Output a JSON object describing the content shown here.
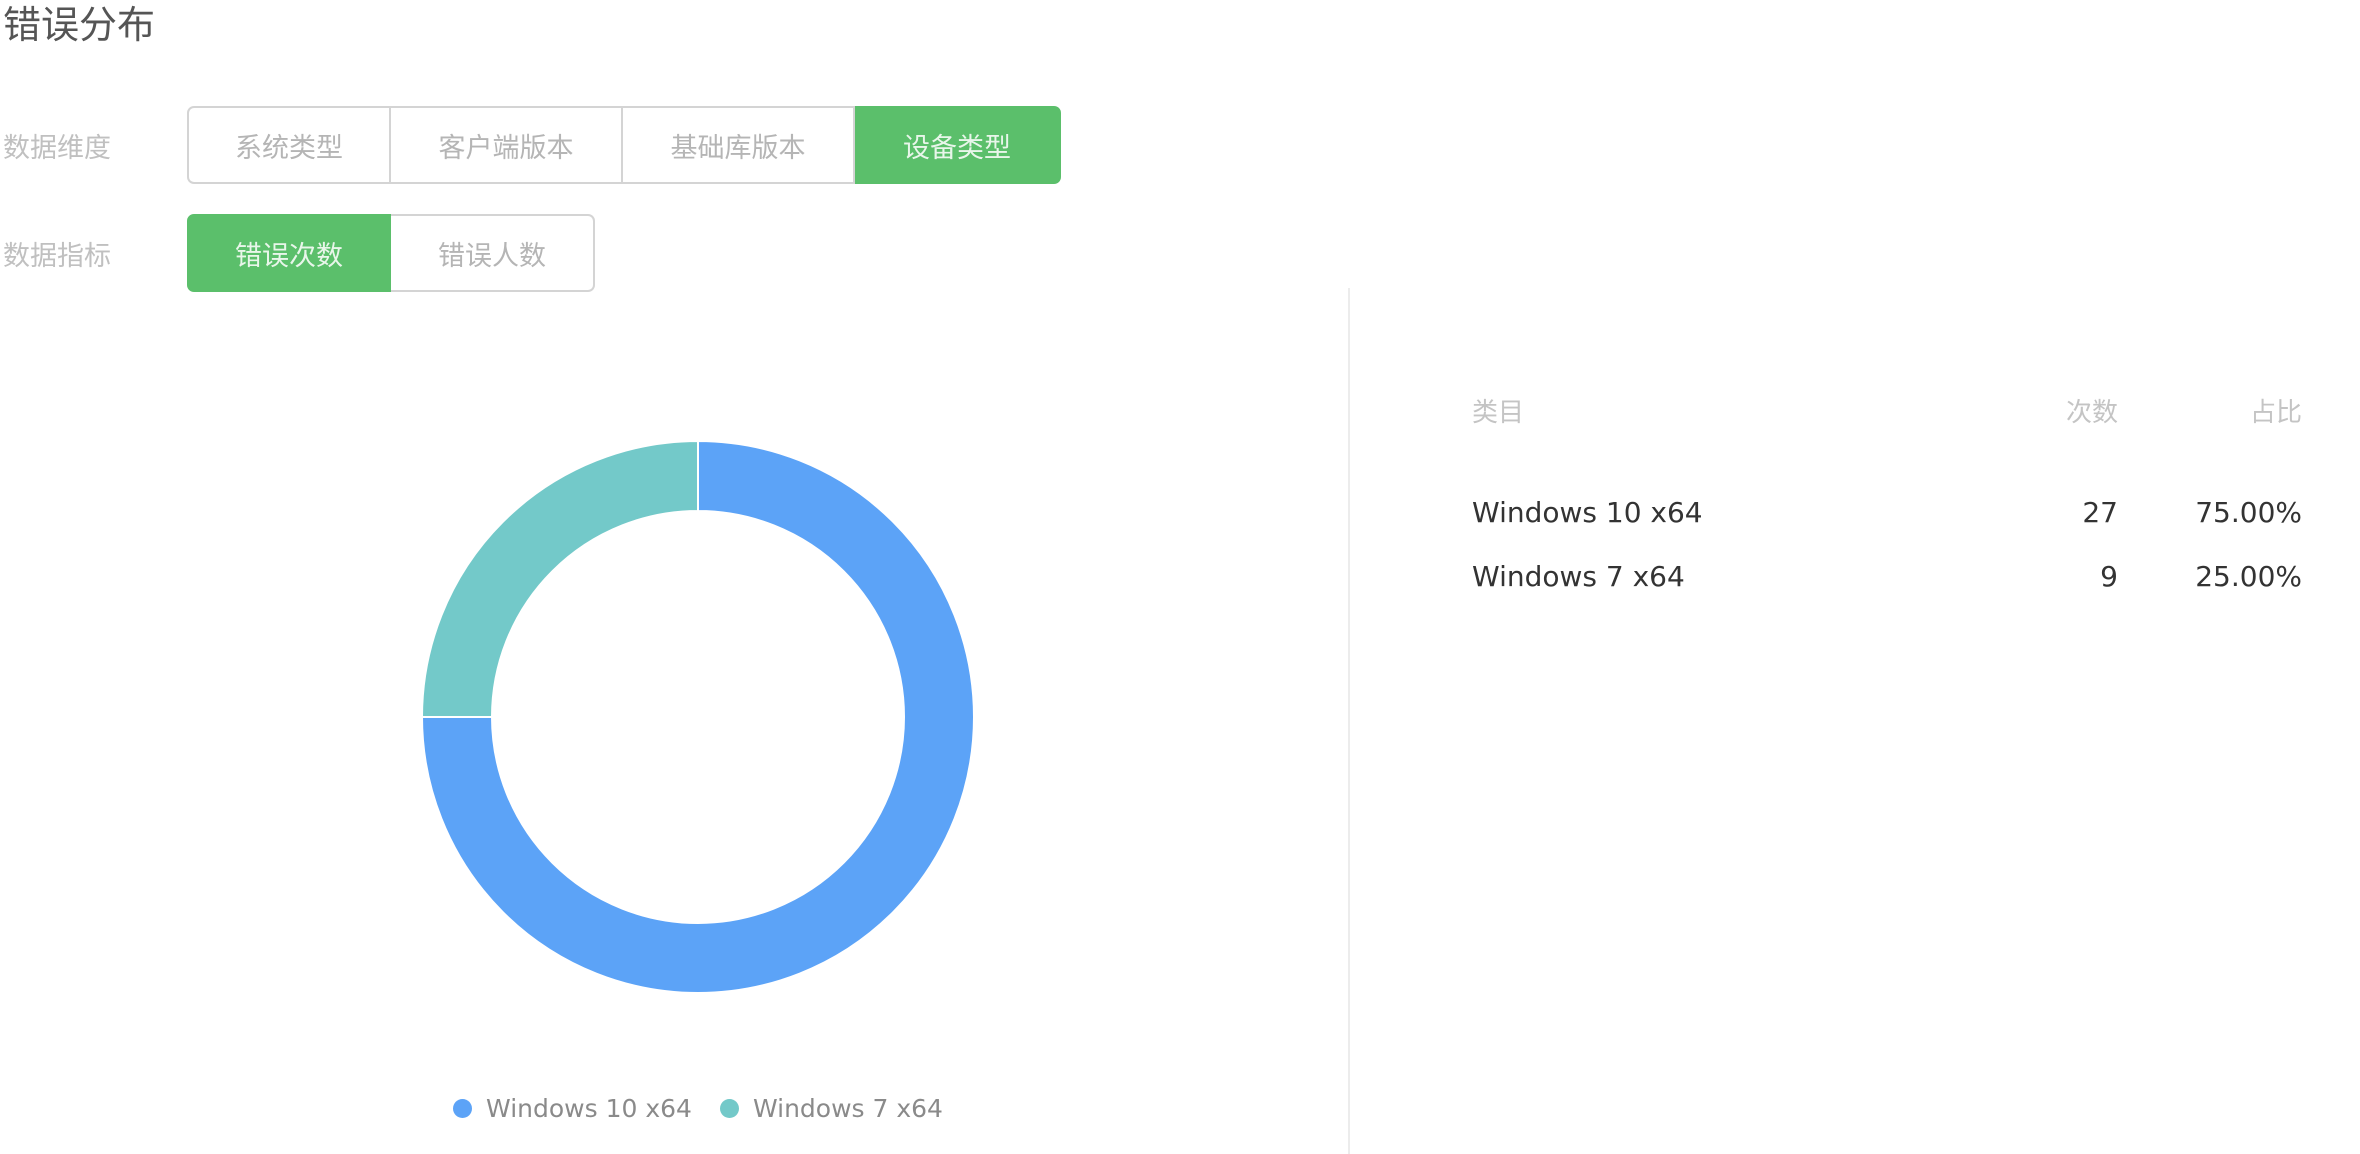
{
  "page": {
    "title": "错误分布"
  },
  "filters": {
    "dimension": {
      "label": "数据维度",
      "options": [
        {
          "label": "系统类型",
          "active": false
        },
        {
          "label": "客户端版本",
          "active": false
        },
        {
          "label": "基础库版本",
          "active": false
        },
        {
          "label": "设备类型",
          "active": true
        }
      ]
    },
    "metric": {
      "label": "数据指标",
      "options": [
        {
          "label": "错误次数",
          "active": true
        },
        {
          "label": "错误人数",
          "active": false
        }
      ]
    }
  },
  "colors": {
    "active_green": "#5bbf6b",
    "series_windows10": "#5ca3f7",
    "series_windows7": "#73c9c9"
  },
  "chart_data": {
    "type": "pie",
    "variant": "donut",
    "legend_position": "bottom",
    "series": [
      {
        "name": "Windows 10 x64",
        "value": 27,
        "color": "#5ca3f7"
      },
      {
        "name": "Windows 7 x64",
        "value": 9,
        "color": "#73c9c9"
      }
    ]
  },
  "table": {
    "headers": {
      "category": "类目",
      "count": "次数",
      "ratio": "占比"
    },
    "rows": [
      {
        "category": "Windows 10 x64",
        "count": "27",
        "ratio": "75.00%"
      },
      {
        "category": "Windows 7 x64",
        "count": "9",
        "ratio": "25.00%"
      }
    ]
  }
}
